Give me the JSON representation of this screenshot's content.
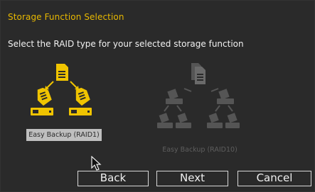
{
  "dialog": {
    "title": "Storage Function Selection",
    "subtitle": "Select the RAID type for your selected storage function"
  },
  "options": [
    {
      "label": "Easy Backup (RAID1)",
      "selected": true,
      "icon": "raid1-backup-icon"
    },
    {
      "label": "Easy Backup (RAID10)",
      "selected": false,
      "disabled": true,
      "icon": "raid10-backup-icon"
    }
  ],
  "buttons": {
    "back": "Back",
    "next": "Next",
    "cancel": "Cancel"
  },
  "colors": {
    "accent": "#e8b800",
    "background": "#2a2a2a",
    "disabled": "#5e5e5e",
    "selection": "#bfbfbf"
  }
}
